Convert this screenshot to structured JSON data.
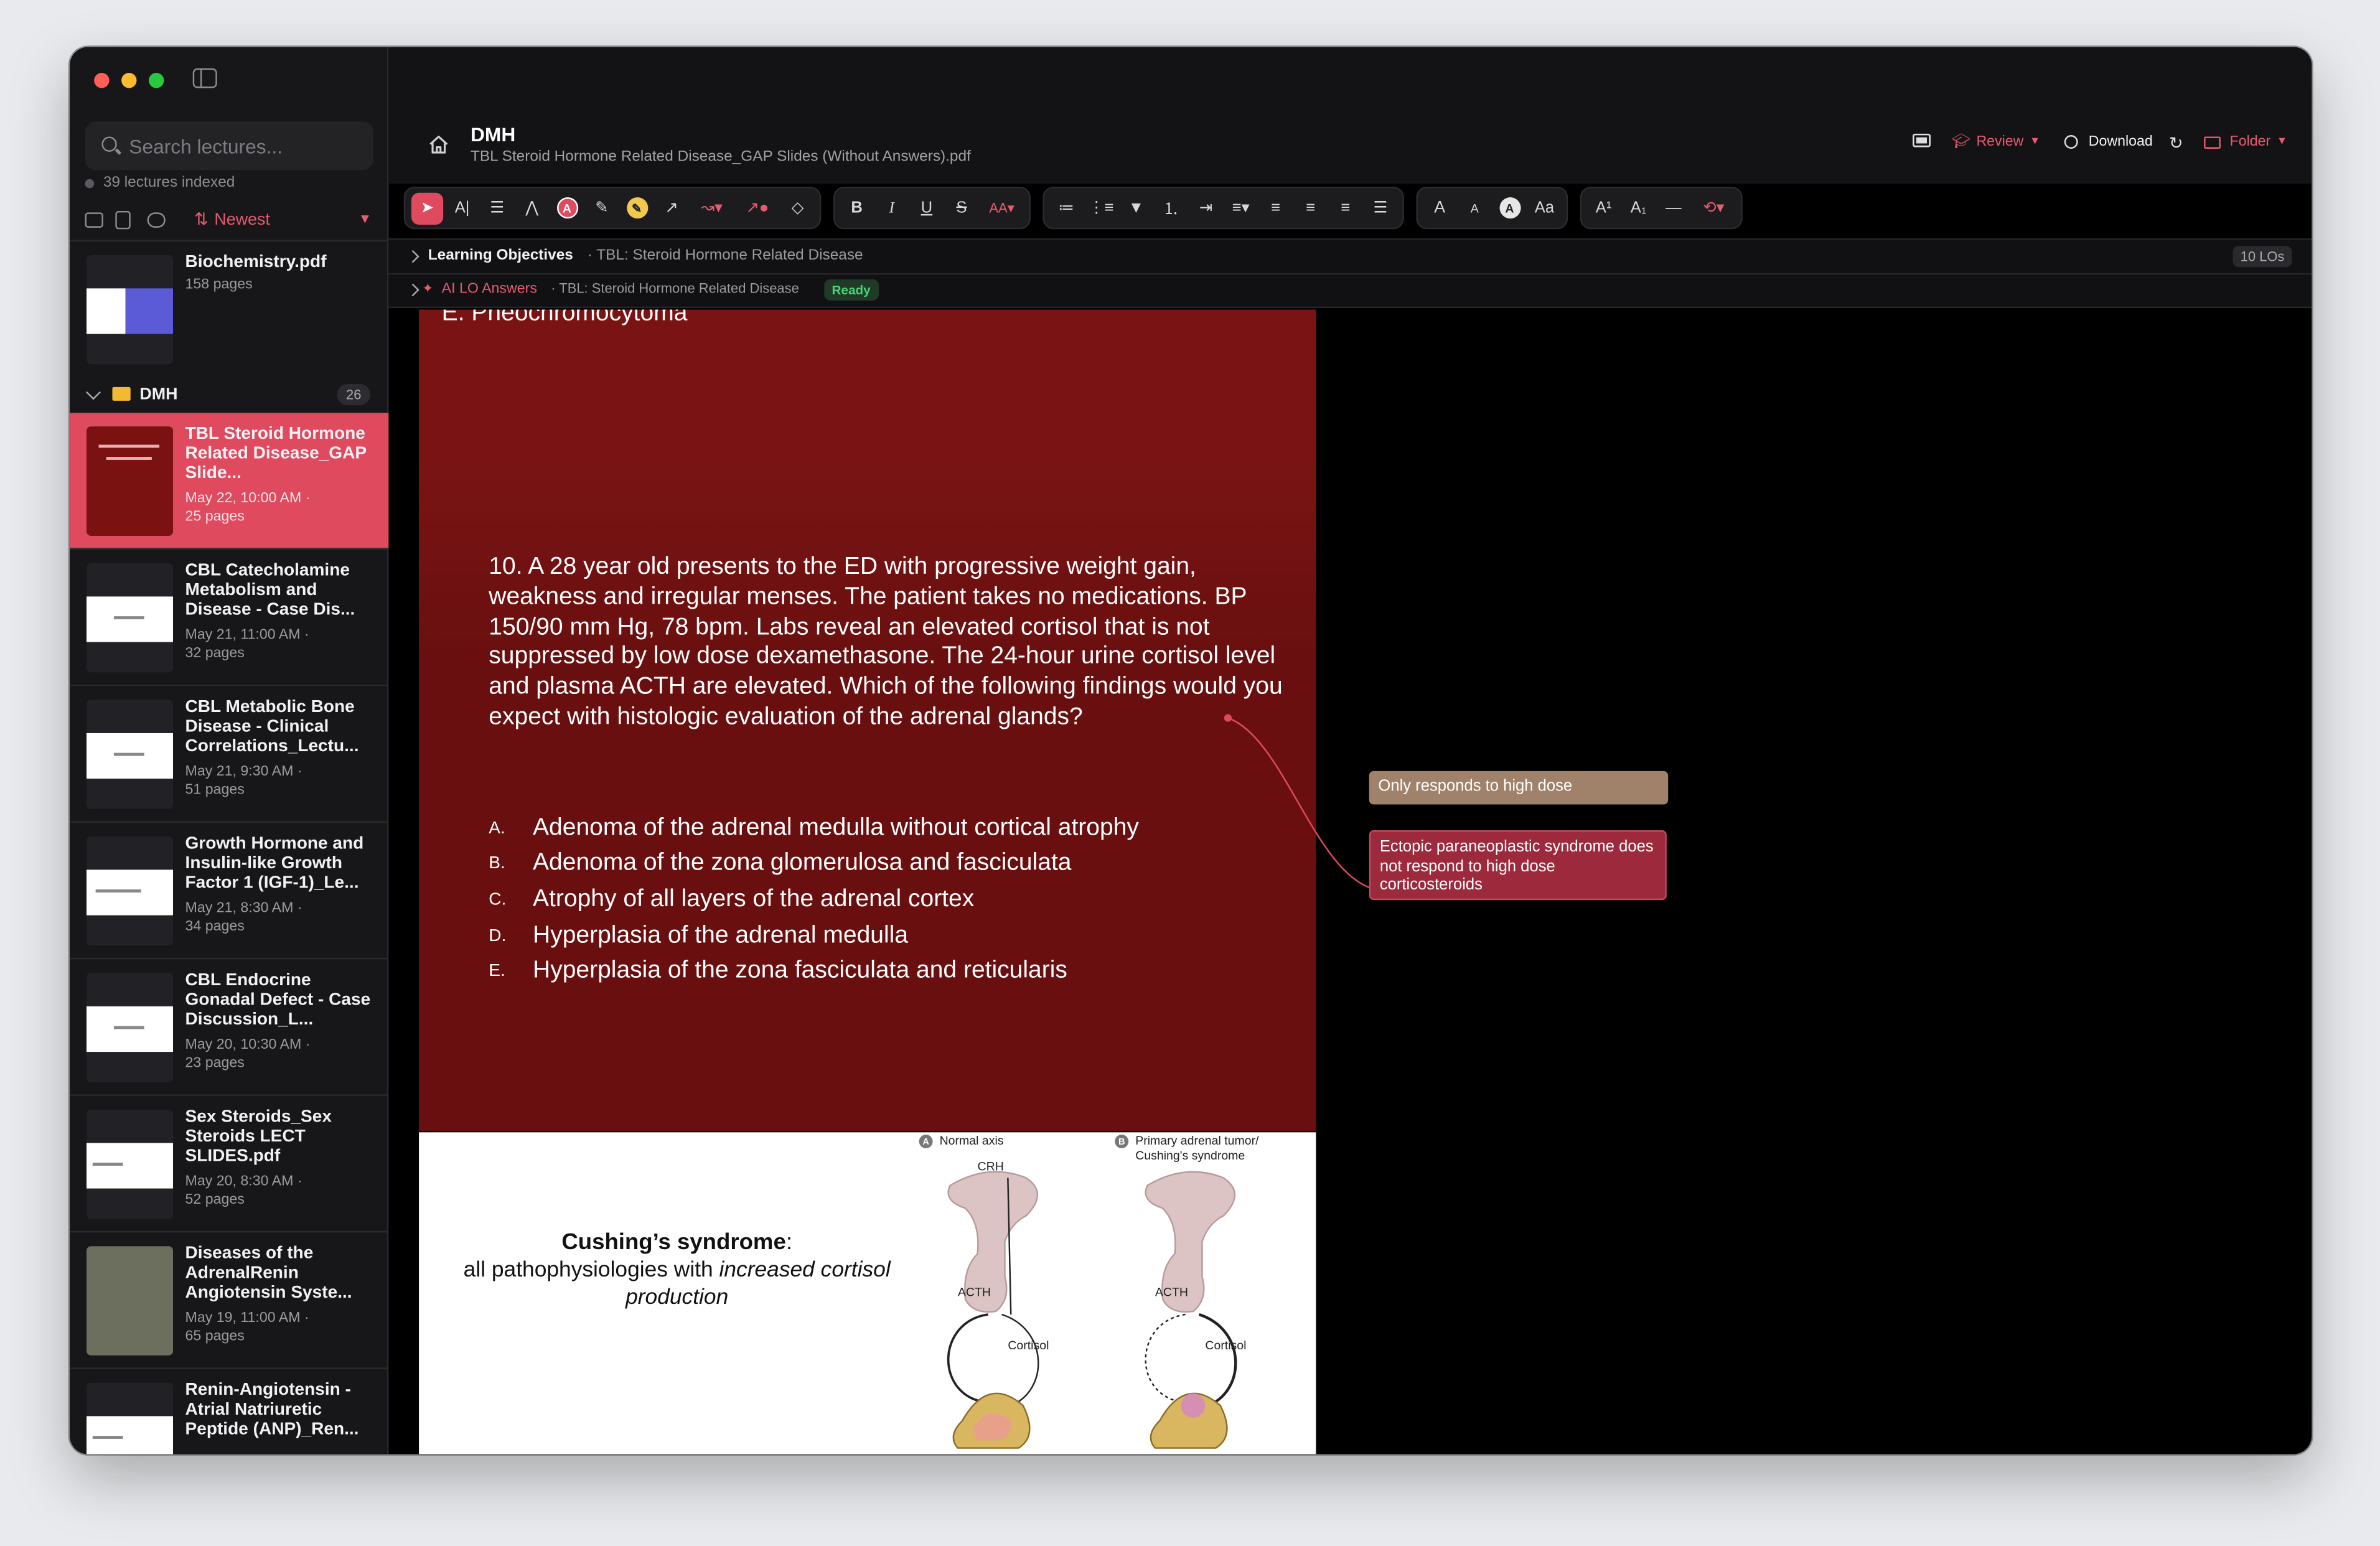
{
  "window": {
    "traffic": [
      "#fe5f57",
      "#febc2e",
      "#28c840"
    ]
  },
  "sidebar": {
    "search_placeholder": "Search lectures...",
    "indexed": "39 lectures indexed",
    "sort_label": "Newest",
    "top_item": {
      "title": "Biochemistry.pdf",
      "meta": "158 pages"
    },
    "folder": {
      "name": "DMH",
      "count": "26"
    },
    "items": [
      {
        "title": "TBL Steroid Hormone Related Disease_GAP Slide...",
        "date": "May 22, 10:00 AM ·",
        "pages": "25 pages",
        "selected": true
      },
      {
        "title": "CBL Catecholamine Metabolism and Disease - Case Dis...",
        "date": "May 21, 11:00 AM ·",
        "pages": "32 pages"
      },
      {
        "title": "CBL Metabolic Bone Disease - Clinical Correlations_Lectu...",
        "date": "May 21, 9:30 AM ·",
        "pages": "51 pages"
      },
      {
        "title": "Growth Hormone and Insulin-like Growth Factor 1 (IGF-1)_Le...",
        "date": "May 21, 8:30 AM ·",
        "pages": "34 pages"
      },
      {
        "title": "CBL Endocrine Gonadal Defect - Case Discussion_L...",
        "date": "May 20, 10:30 AM ·",
        "pages": "23 pages"
      },
      {
        "title": "Sex Steroids_Sex Steroids LECT SLIDES.pdf",
        "date": "May 20, 8:30 AM ·",
        "pages": "52 pages"
      },
      {
        "title": "Diseases of the AdrenalRenin Angiotensin Syste...",
        "date": "May 19, 11:00 AM ·",
        "pages": "65 pages"
      },
      {
        "title": "Renin-Angiotensin - Atrial Natriuretic Peptide (ANP)_Ren...",
        "date": "",
        "pages": ""
      }
    ]
  },
  "header": {
    "title": "DMH",
    "subtitle": "TBL Steroid Hormone Related Disease_GAP Slides (Without Answers).pdf",
    "review": "Review",
    "download": "Download",
    "folder": "Folder"
  },
  "toolbar": {
    "bold": "B",
    "italic": "I",
    "underline": "U",
    "strike": "S",
    "case": "AA",
    "size_a_big": "A",
    "size_a_small": "A",
    "size_a_circle": "A",
    "aa": "Aa",
    "superscript": "A¹",
    "subscript": "A₁"
  },
  "lo_bar": {
    "label": "Learning Objectives",
    "desc": "· TBL: Steroid Hormone Related Disease",
    "count": "10 LOs"
  },
  "ai_bar": {
    "label": "AI LO Answers",
    "desc": "· TBL: Steroid Hormone Related Disease",
    "status": "Ready"
  },
  "slide": {
    "prev_option": "E.    Pheochromocytoma",
    "question": "10. A 28 year old presents to the ED with progressive weight gain, weakness and irregular menses.  The patient takes no medications.  BP 150/90 mm Hg, 78 bpm.  Labs reveal an elevated cortisol that is not suppressed by low dose dexamethasone.  The 24-hour urine cortisol level and plasma ACTH are elevated.  Which of the following findings would you expect with histologic evaluation of the adrenal glands?",
    "options": [
      {
        "letter": "A.",
        "text": "Adenoma of the adrenal medulla without cortical atrophy"
      },
      {
        "letter": "B.",
        "text": "Adenoma of the zona glomerulosa and fasciculata"
      },
      {
        "letter": "C.",
        "text": "Atrophy of all layers of the adrenal cortex"
      },
      {
        "letter": "D.",
        "text": "Hyperplasia of the adrenal medulla"
      },
      {
        "letter": "E.",
        "text": "Hyperplasia of the zona fasciculata and reticularis"
      }
    ]
  },
  "slide2": {
    "title": "Cushing’s syndrome",
    "colon": ":",
    "line1": "all pathophysiologies with ",
    "line1_it": "increased cortisol",
    "line2_it": "production",
    "panel_a": "Normal axis",
    "panel_b_1": "Primary adrenal tumor/",
    "panel_b_2": "Cushing's syndrome",
    "crh": "CRH",
    "acth": "ACTH",
    "cortisol": "Cortisol",
    "a": "A",
    "b": "B"
  },
  "notes": [
    {
      "text": "Only responds to high dose"
    },
    {
      "text": "Ectopic paraneoplastic syndrome does not respond to high dose corticosteroids"
    }
  ]
}
